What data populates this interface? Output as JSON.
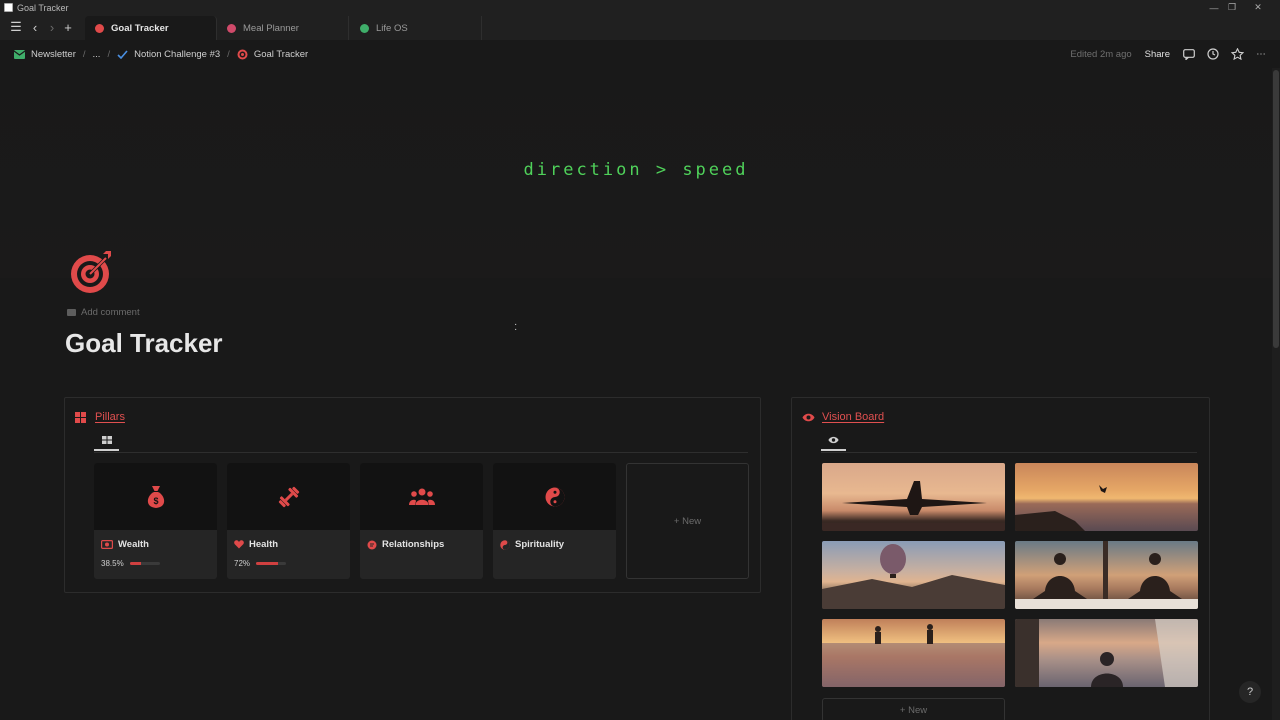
{
  "window": {
    "title": "Goal Tracker"
  },
  "tabs": [
    {
      "label": "Goal Tracker",
      "active": true,
      "icon": "target-icon",
      "color": "#e04a4a"
    },
    {
      "label": "Meal Planner",
      "active": false,
      "icon": "cutlery-icon",
      "color": "#d04a6a"
    },
    {
      "label": "Life OS",
      "active": false,
      "icon": "globe-icon",
      "color": "#3fae6a"
    }
  ],
  "breadcrumb": [
    {
      "label": "Newsletter",
      "icon": "mail-icon"
    },
    {
      "label": "..."
    },
    {
      "label": "Notion Challenge #3",
      "icon": "check-icon"
    },
    {
      "label": "Goal Tracker",
      "icon": "target-icon"
    }
  ],
  "topbar": {
    "edited": "Edited 2m ago",
    "share": "Share"
  },
  "cover": {
    "text": "direction > speed",
    "text_color": "#4fd15a"
  },
  "page": {
    "add_comment": "Add comment",
    "title": "Goal Tracker",
    "accent": "#e04a4a"
  },
  "pillars": {
    "title": "Pillars",
    "new_label": "+ New",
    "cards": [
      {
        "name": "Wealth",
        "icon": "money-bag-icon",
        "progress_label": "38.5%",
        "progress": 0.385
      },
      {
        "name": "Health",
        "icon": "dumbbell-icon",
        "progress_label": "72%",
        "progress": 0.72
      },
      {
        "name": "Relationships",
        "icon": "people-icon"
      },
      {
        "name": "Spirituality",
        "icon": "yin-yang-icon"
      }
    ]
  },
  "vision_board": {
    "title": "Vision Board",
    "new_label": "+ New",
    "photos": [
      "airplane-sunset",
      "cliff-jump-sunset",
      "hot-air-balloon",
      "meditation-couple",
      "surfers-sunset",
      "beach-house-window"
    ]
  },
  "help": "?"
}
